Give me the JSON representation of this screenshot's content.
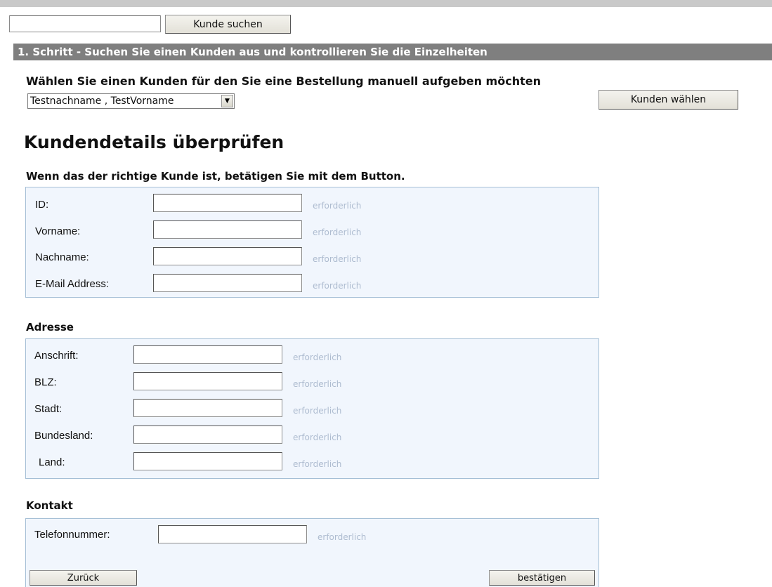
{
  "search": {
    "value": "",
    "button_label": "Kunde suchen"
  },
  "step": {
    "title": "1. Schritt - Suchen Sie einen Kunden aus und kontrollieren Sie die Einzelheiten"
  },
  "customer_select": {
    "label": "Wählen Sie einen Kunden für den Sie eine Bestellung manuell aufgeben möchten",
    "selected": "Testnachname , TestVorname",
    "button_label": "Kunden wählen"
  },
  "details": {
    "heading": "Kundendetails überprüfen",
    "hint": "Wenn das der richtige Kunde ist, betätigen Sie mit dem Button.",
    "fields": [
      {
        "label": "ID:",
        "required": "erforderlich"
      },
      {
        "label": "Vorname:",
        "required": "erforderlich"
      },
      {
        "label": "Nachname:",
        "required": "erforderlich"
      },
      {
        "label": "E-Mail Address:",
        "required": "erforderlich"
      }
    ]
  },
  "address": {
    "title": "Adresse",
    "fields": [
      {
        "label": "Anschrift:",
        "required": "erforderlich"
      },
      {
        "label": "BLZ:",
        "required": "erforderlich"
      },
      {
        "label": "Stadt:",
        "required": "erforderlich"
      },
      {
        "label": "Bundesland:",
        "required": "erforderlich"
      },
      {
        "label": "Land:",
        "required": "erforderlich"
      }
    ]
  },
  "contact": {
    "title": "Kontakt",
    "fields": [
      {
        "label": "Telefonnummer:",
        "required": "erforderlich"
      }
    ]
  },
  "actions": {
    "back_label": "Zurück",
    "confirm_label": "bestätigen"
  }
}
